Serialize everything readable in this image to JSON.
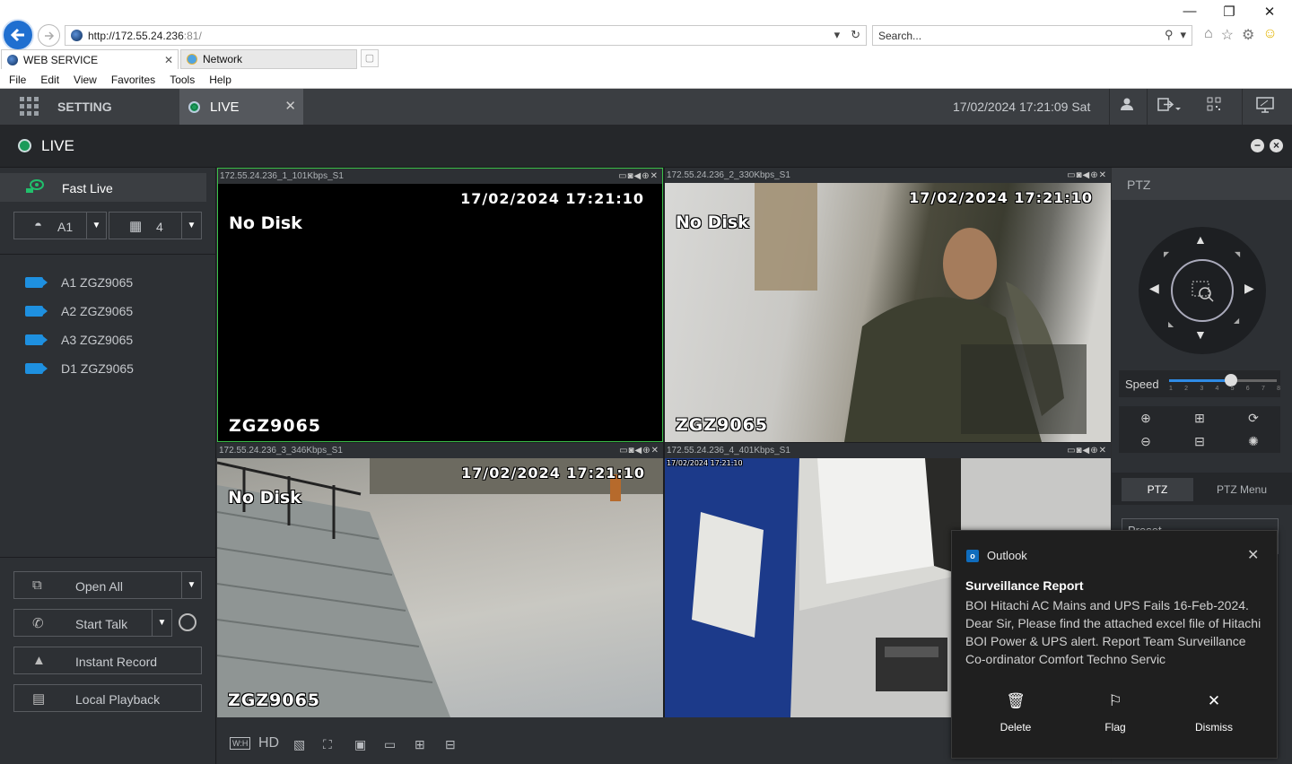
{
  "browser": {
    "url_host": "http://172.55.24.236",
    "url_port": ":81/",
    "search_placeholder": "Search...",
    "tabs": [
      {
        "label": "WEB SERVICE",
        "active": true
      },
      {
        "label": "Network",
        "active": false
      }
    ],
    "menu": [
      "File",
      "Edit",
      "View",
      "Favorites",
      "Tools",
      "Help"
    ]
  },
  "app": {
    "setting_label": "SETTING",
    "live_tab_label": "LIVE",
    "datetime": "17/02/2024 17:21:09 Sat",
    "page_title": "LIVE"
  },
  "left": {
    "fast_live": "Fast Live",
    "select_channel": "A1",
    "select_layout": "4",
    "cameras": [
      {
        "label": "A1 ZGZ9065"
      },
      {
        "label": "A2 ZGZ9065"
      },
      {
        "label": "A3 ZGZ9065"
      },
      {
        "label": "D1 ZGZ9065"
      }
    ],
    "actions": {
      "open_all": "Open All",
      "start_talk": "Start Talk",
      "instant_record": "Instant Record",
      "local_playback": "Local Playback"
    }
  },
  "video": {
    "cells": [
      {
        "title": "172.55.24.236_1_101Kbps_S1",
        "time": "17/02/2024 17:21:10",
        "nodisk": "No Disk",
        "name": "ZGZ9065"
      },
      {
        "title": "172.55.24.236_2_330Kbps_S1",
        "time": "17/02/2024 17:21:10",
        "nodisk": "No Disk",
        "name": "ZGZ9065"
      },
      {
        "title": "172.55.24.236_3_346Kbps_S1",
        "time": "17/02/2024 17:21:10",
        "nodisk": "No Disk",
        "name": "ZGZ9065"
      },
      {
        "title": "172.55.24.236_4_401Kbps_S1",
        "time": "17/02/2024 17:21:10",
        "nodisk": "",
        "name": ""
      }
    ],
    "bottom_hd": "HD",
    "bottom_wh": "W:H"
  },
  "ptz": {
    "title": "PTZ",
    "speed_label": "Speed",
    "speed_value": 5,
    "speed_ticks": [
      "1",
      "2",
      "3",
      "4",
      "5",
      "6",
      "7",
      "8"
    ],
    "tab_ptz": "PTZ",
    "tab_menu": "PTZ Menu",
    "preset_label": "Preset"
  },
  "toast": {
    "app": "Outlook",
    "subject": "Surveillance Report",
    "body": "BOI Hitachi AC Mains and UPS Fails  16-Feb-2024.\nDear Sir,  Please find the attached excel file of Hitachi BOI Power & UPS alert.  Report Team Surveillance Co-ordinator   Comfort Techno Servic",
    "actions": {
      "delete": "Delete",
      "flag": "Flag",
      "dismiss": "Dismiss"
    }
  },
  "colors": {
    "accent_green": "#21c06c",
    "camera_blue": "#1e90e0",
    "selected_border": "#3cc04a",
    "outlook_blue": "#0f6cbd"
  }
}
